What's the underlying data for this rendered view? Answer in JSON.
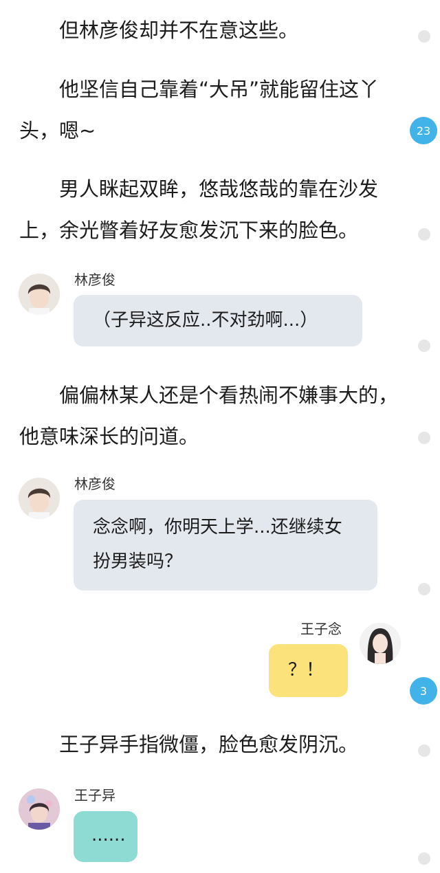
{
  "story": {
    "p1": "但林彦俊却并不在意这些。",
    "p2": "他坚信自己靠着“大吊”就能留住这丫头，嗯~",
    "p3": "男人眯起双眸，悠哉悠哉的靠在沙发上，余光瞥着好友愈发沉下来的脸色。",
    "p4": "偏偏林某人还是个看热闹不嫌事大的，他意味深长的问道。",
    "p5": "王子异手指微僵，脸色愈发阴沉。"
  },
  "chat": {
    "m1": {
      "speaker": "林彦俊",
      "text": "（子异这反应..不对劲啊...）"
    },
    "m2": {
      "speaker": "林彦俊",
      "text": "念念啊，你明天上学...还继续女扮男装吗？"
    },
    "m3": {
      "speaker": "王子念",
      "text": "？！"
    },
    "m4": {
      "speaker": "王子异",
      "text": "......"
    }
  },
  "comments": {
    "c1": "23",
    "c2": "3"
  },
  "colors": {
    "accent_badge": "#42b3e8",
    "bubble_gray": "#e3e7ee",
    "bubble_yellow": "#fbe27a",
    "bubble_teal": "#8edbd3"
  }
}
